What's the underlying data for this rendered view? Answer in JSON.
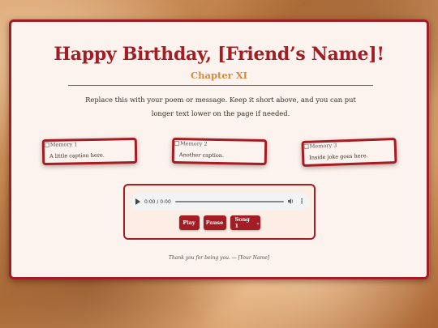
{
  "page": {
    "title": "Happy Birthday, [Friend’s Name]!",
    "subtitle": "Chapter XI",
    "message": "Replace this with your poem or message. Keep it short above, and you can put longer text lower on the page if needed."
  },
  "memories": [
    {
      "alt": "Memory 1",
      "caption": "A little caption here."
    },
    {
      "alt": "Memory 2",
      "caption": "Another caption."
    },
    {
      "alt": "Memory 3",
      "caption": "Inside joke goes here."
    }
  ],
  "player": {
    "time": "0:00 / 0:00",
    "play_label": "Play",
    "pause_label": "Pause",
    "song_selected": "Song 1"
  },
  "footer": "Thank you for being you. — [Your Name]",
  "colors": {
    "accent": "#a51d24",
    "subtitle": "#d88a3a",
    "card_bg": "#fdf3ee"
  },
  "icons": {
    "play": "play-icon",
    "volume": "volume-icon",
    "more": "more-options-icon",
    "chevron": "chevron-down-icon",
    "broken_image": "broken-image-icon"
  }
}
